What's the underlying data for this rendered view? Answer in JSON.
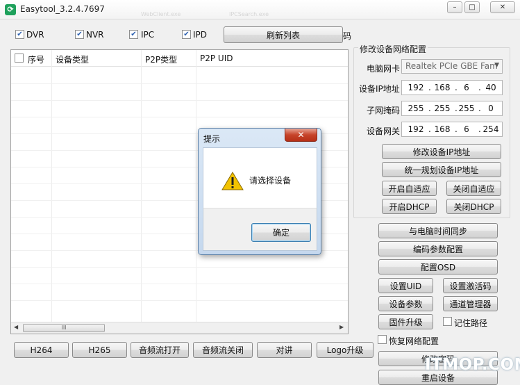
{
  "window": {
    "title": "Easytool_3.2.4.7697",
    "ghost_text_1": "WebClient.exe",
    "ghost_text_2": "IPCSearch.exe",
    "minimize_glyph": "–",
    "maximize_glyph": "□",
    "close_glyph": "✕"
  },
  "filters": [
    {
      "label": "DVR",
      "checked": true
    },
    {
      "label": "NVR",
      "checked": true
    },
    {
      "label": "IPC",
      "checked": true
    },
    {
      "label": "IPD",
      "checked": true
    }
  ],
  "refresh_button": "刷新列表",
  "stray_char": "码",
  "list": {
    "columns": [
      "序号",
      "设备类型",
      "P2P类型",
      "P2P UID"
    ],
    "scroll_grip": "III",
    "scroll_left": "◀",
    "scroll_right": "▶"
  },
  "network": {
    "group_title": "修改设备网络配置",
    "nic_label": "电脑网卡",
    "nic_value": "Realtek PCIe GBE Fam",
    "ip_label": "设备IP地址",
    "ip": [
      "192",
      "168",
      "6",
      "40"
    ],
    "mask_label": "子网掩码",
    "mask": [
      "255",
      "255",
      "255",
      "0"
    ],
    "gateway_label": "设备网关",
    "gateway": [
      "192",
      "168",
      "6",
      "254"
    ],
    "modify_ip": "修改设备IP地址",
    "plan_ip": "统一规划设备IP地址",
    "auto_on": "开启自适应",
    "auto_off": "关闭自适应",
    "dhcp_on": "开启DHCP",
    "dhcp_off": "关闭DHCP"
  },
  "actions": {
    "sync_time": "与电脑时间同步",
    "encode_config": "编码参数配置",
    "osd_config": "配置OSD",
    "set_uid": "设置UID",
    "set_activation": "设置激活码",
    "device_params": "设备参数",
    "channel_manager": "通道管理器",
    "firmware_upgrade": "固件升级",
    "remember_path": "记住路径",
    "restore_network": "恢复网络配置",
    "change_password": "修改密码",
    "reboot_device": "重启设备"
  },
  "bottom_buttons": [
    "H264",
    "H265",
    "音频流打开",
    "音频流关闭",
    "对讲",
    "Logo升级"
  ],
  "dialog": {
    "title": "提示",
    "message": "请选择设备",
    "ok": "确定",
    "close_glyph": "✕",
    "warning_glyph": "!"
  },
  "watermark": "ITMOP.COM",
  "colors": {
    "accent": "#1fa15c",
    "dialog_frame": "#c5d8ee",
    "close_red": "#c7442a",
    "warning_yellow": "#f2c200"
  }
}
